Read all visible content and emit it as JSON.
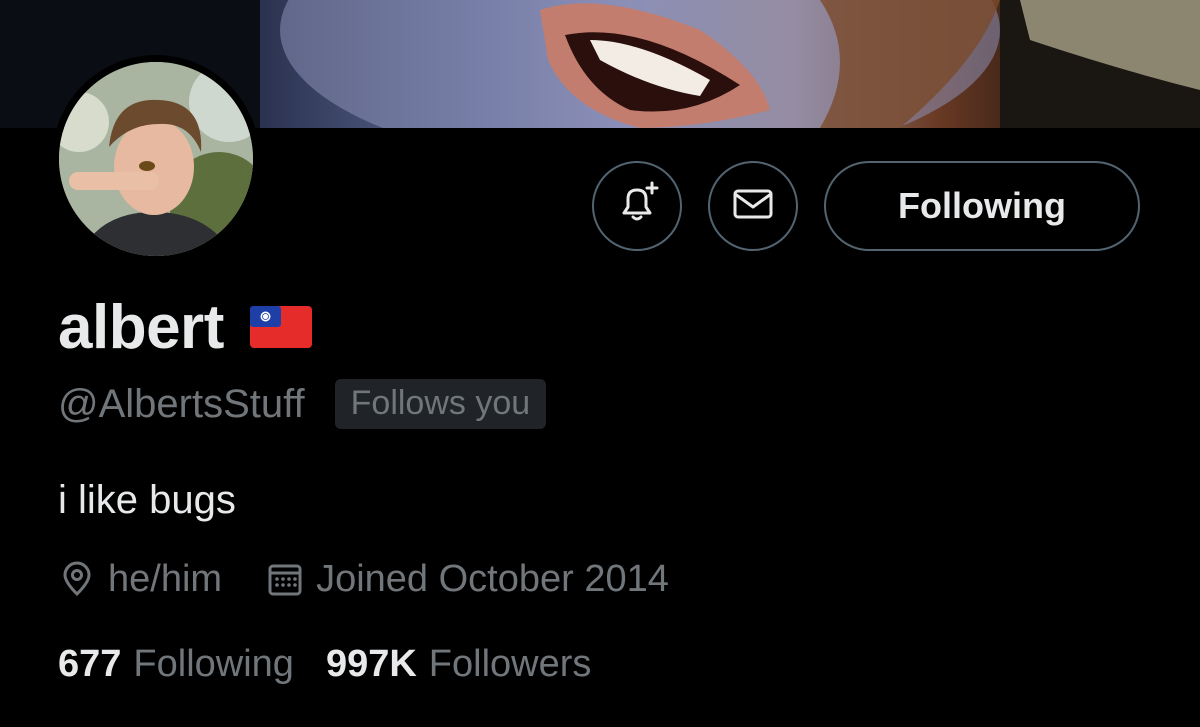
{
  "profile": {
    "display_name": "albert",
    "handle": "@AlbertsStuff",
    "follows_you_label": "Follows you",
    "bio": "i like bugs",
    "pronouns": "he/him",
    "joined": "Joined October 2014"
  },
  "actions": {
    "following_label": "Following"
  },
  "stats": {
    "following_count": "677",
    "following_label": "Following",
    "followers_count": "997K",
    "followers_label": "Followers"
  },
  "icons": {
    "notify": "bell-plus-icon",
    "message": "envelope-icon",
    "location": "location-pin-icon",
    "calendar": "calendar-icon",
    "flag": "taiwan-flag-icon"
  },
  "colors": {
    "background": "#000000",
    "primary_text": "#e7e9ea",
    "secondary_text": "#71767b",
    "border": "#536471",
    "badge_bg": "#202327"
  }
}
